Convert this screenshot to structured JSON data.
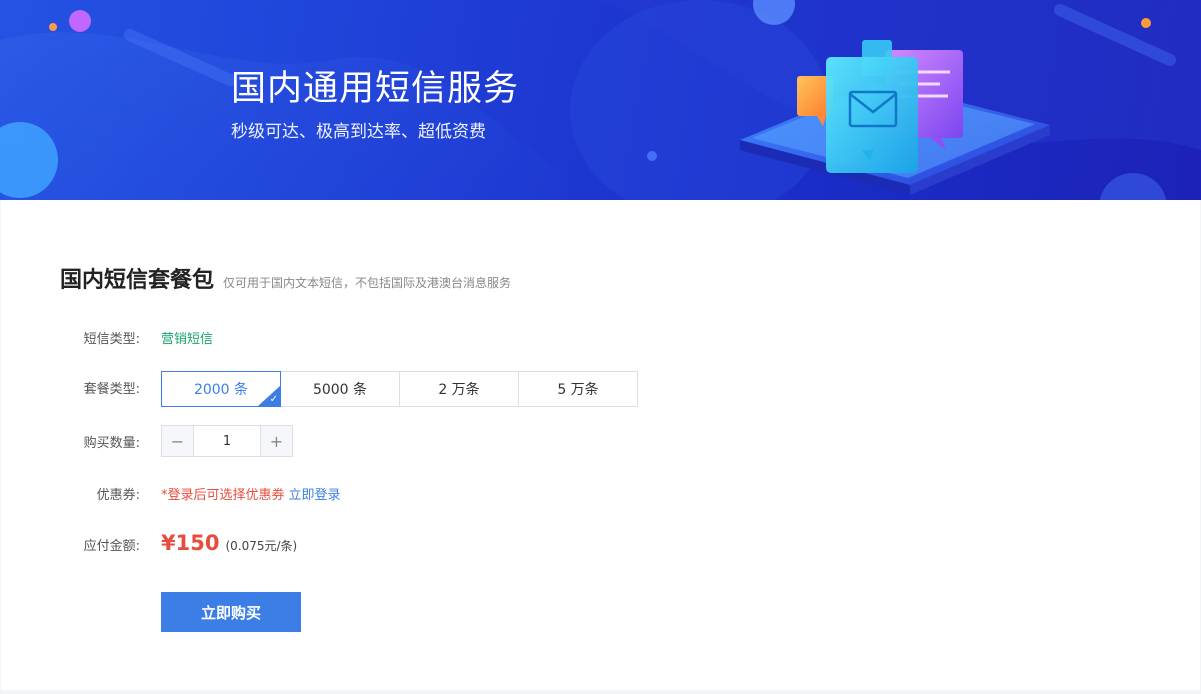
{
  "colors": {
    "banner_start": "#2453e3",
    "banner_end": "#1c22b8",
    "accent_blue": "#3d7ee6",
    "accent_green": "#1aa36a",
    "accent_red": "#e84c3d"
  },
  "banner": {
    "title": "国内通用短信服务",
    "subtitle": "秒级可达、极高到达率、超低资费",
    "illustration_icon": "sms-message-bubbles-illustration"
  },
  "section": {
    "title": "国内短信套餐包",
    "note": "仅可用于国内文本短信，不包括国际及港澳台消息服务"
  },
  "form": {
    "sms_type": {
      "label": "短信类型:",
      "value": "营销短信"
    },
    "plan_type": {
      "label": "套餐类型:",
      "options": [
        "2000 条",
        "5000 条",
        "2 万条",
        "5 万条"
      ],
      "selected": "2000 条"
    },
    "quantity": {
      "label": "购买数量:",
      "value": "1",
      "minus": "−",
      "plus": "+"
    },
    "coupon": {
      "label": "优惠券:",
      "note": "*登录后可选择优惠券",
      "link": "立即登录"
    },
    "amount": {
      "label": "应付金额:",
      "price": "¥150",
      "unit_price": "(0.075元/条)"
    }
  },
  "buy_button": "立即购买"
}
